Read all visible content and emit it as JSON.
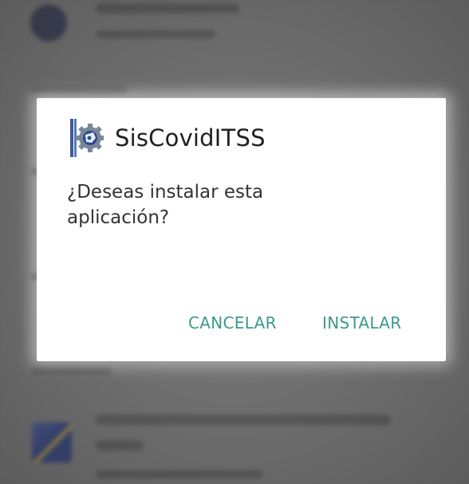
{
  "dialog": {
    "app_name": "SisCovidITSS",
    "app_icon": "tech-institute-gear-logo-icon",
    "question": "¿Deseas instalar esta aplicación?",
    "cancel_label": "CANCELAR",
    "install_label": "INSTALAR"
  },
  "colors": {
    "accent": "#3a9a8a",
    "dialog_bg": "#ffffff",
    "scrim": "#6f6f6f"
  }
}
